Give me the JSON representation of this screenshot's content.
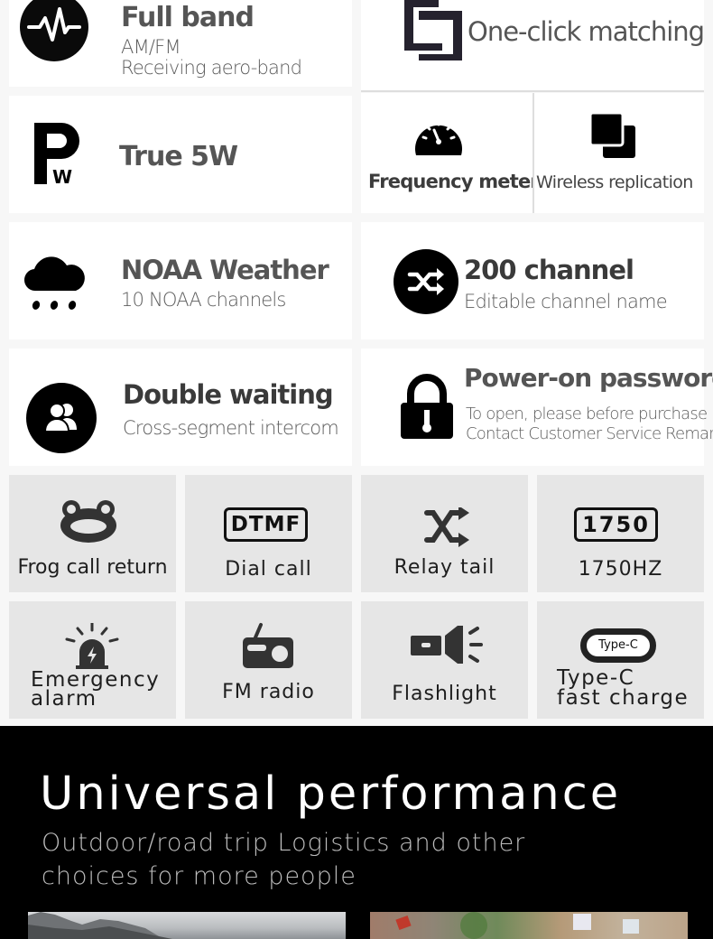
{
  "features": {
    "full_band": {
      "title": "Full band",
      "line1": "AM/FM",
      "line2": "Receiving aero-band",
      "icon": "waveform-icon"
    },
    "one_click": {
      "title": "One-click matching",
      "icon": "pairing-logo-icon"
    },
    "true_5w": {
      "title": "True 5W",
      "icon": "power-watt-icon",
      "icon_letter": "P",
      "icon_sub": "W"
    },
    "frequency_meter": {
      "title": "Frequency meter",
      "icon": "speedometer-icon"
    },
    "wireless_replication": {
      "title": "Wireless replication",
      "icon": "copy-icon"
    },
    "noaa": {
      "title": "NOAA Weather",
      "subtitle": "10 NOAA channels",
      "icon": "rain-cloud-icon"
    },
    "channels": {
      "title": "200 channel",
      "subtitle": "Editable channel name",
      "icon": "shuffle-icon"
    },
    "double_waiting": {
      "title": "Double waiting",
      "subtitle": "Cross-segment intercom",
      "icon": "users-icon"
    },
    "password": {
      "title": "Power-on password",
      "line1": "To open, please before purchase",
      "line2": "Contact Customer Service Remarks",
      "icon": "padlock-icon"
    }
  },
  "grid": [
    {
      "label": "Frog call return",
      "icon": "frog-icon"
    },
    {
      "label": "Dial call",
      "icon": "dtmf-badge-icon",
      "badge": "DTMF"
    },
    {
      "label": "Relay tail",
      "icon": "shuffle-icon"
    },
    {
      "label": "1750HZ",
      "icon": "tone-badge-icon",
      "badge": "1750"
    },
    {
      "label_line1": "Emergency",
      "label_line2": "alarm",
      "icon": "siren-icon"
    },
    {
      "label": "FM radio",
      "icon": "radio-icon"
    },
    {
      "label": "Flashlight",
      "icon": "flashlight-icon"
    },
    {
      "label_line1": "Type-C",
      "label_line2": "fast charge",
      "icon": "usb-c-port-icon",
      "badge": "Type-C"
    }
  ],
  "performance": {
    "title": "Universal performance",
    "tagline_line1": "Outdoor/road trip Logistics and other",
    "tagline_line2": "choices for more people",
    "photos": [
      {
        "subject": "mountain-landscape"
      },
      {
        "subject": "aerial-city"
      }
    ]
  }
}
